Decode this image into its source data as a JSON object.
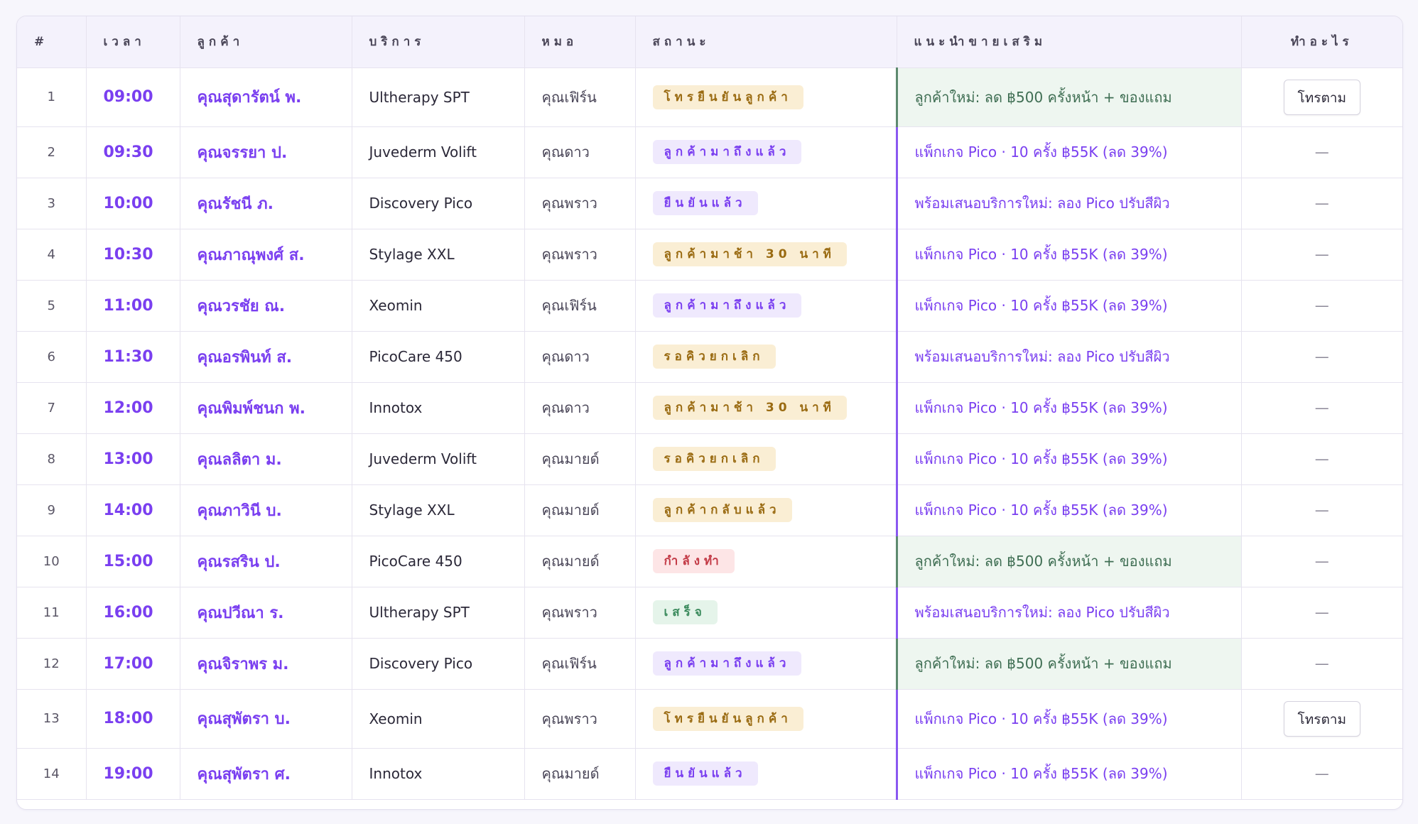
{
  "columns": {
    "num": "#",
    "time": "เวลา",
    "customer": "ลูกค้า",
    "service": "บริการ",
    "doctor": "หมอ",
    "status": "สถานะ",
    "upsell": "แนะนำขายเสริม",
    "action": "ทำอะไร"
  },
  "colors": {
    "accent": "#7a3ff0",
    "promo_bg": "#eef6f0",
    "promo_text": "#3f6e53",
    "badge_amber": "#faeed4",
    "badge_purple": "#efe9fd",
    "badge_red": "#fde5e6",
    "badge_green": "#e5f4ea"
  },
  "rows": [
    {
      "num": "1",
      "time": "09:00",
      "customer": "คุณสุดารัตน์ พ.",
      "service": "Ultherapy SPT",
      "doctor": "คุณเฟิร์น",
      "status": "โทรยืนยันลูกค้า",
      "status_tone": "amber",
      "upsell": "ลูกค้าใหม่: ลด ฿500 ครั้งหน้า + ของแถม",
      "upsell_tone": "promo",
      "action": "โทรตาม",
      "action_type": "button"
    },
    {
      "num": "2",
      "time": "09:30",
      "customer": "คุณจรรยา ป.",
      "service": "Juvederm Volift",
      "doctor": "คุณดาว",
      "status": "ลูกค้ามาถึงแล้ว",
      "status_tone": "purple",
      "upsell": "แพ็กเกจ Pico · 10 ครั้ง ฿55K (ลด 39%)",
      "upsell_tone": "normal",
      "action": "—",
      "action_type": "dash"
    },
    {
      "num": "3",
      "time": "10:00",
      "customer": "คุณรัชนี ภ.",
      "service": "Discovery Pico",
      "doctor": "คุณพราว",
      "status": "ยืนยันแล้ว",
      "status_tone": "purple",
      "upsell": "พร้อมเสนอบริการใหม่: ลอง Pico ปรับสีผิว",
      "upsell_tone": "normal",
      "action": "—",
      "action_type": "dash"
    },
    {
      "num": "4",
      "time": "10:30",
      "customer": "คุณภาณุพงศ์ ส.",
      "service": "Stylage XXL",
      "doctor": "คุณพราว",
      "status": "ลูกค้ามาช้า 30 นาที",
      "status_tone": "amber",
      "upsell": "แพ็กเกจ Pico · 10 ครั้ง ฿55K (ลด 39%)",
      "upsell_tone": "normal",
      "action": "—",
      "action_type": "dash"
    },
    {
      "num": "5",
      "time": "11:00",
      "customer": "คุณวรชัย ณ.",
      "service": "Xeomin",
      "doctor": "คุณเฟิร์น",
      "status": "ลูกค้ามาถึงแล้ว",
      "status_tone": "purple",
      "upsell": "แพ็กเกจ Pico · 10 ครั้ง ฿55K (ลด 39%)",
      "upsell_tone": "normal",
      "action": "—",
      "action_type": "dash"
    },
    {
      "num": "6",
      "time": "11:30",
      "customer": "คุณอรพินท์ ส.",
      "service": "PicoCare 450",
      "doctor": "คุณดาว",
      "status": "รอคิวยกเลิก",
      "status_tone": "amber",
      "upsell": "พร้อมเสนอบริการใหม่: ลอง Pico ปรับสีผิว",
      "upsell_tone": "normal",
      "action": "—",
      "action_type": "dash"
    },
    {
      "num": "7",
      "time": "12:00",
      "customer": "คุณพิมพ์ชนก พ.",
      "service": "Innotox",
      "doctor": "คุณดาว",
      "status": "ลูกค้ามาช้า 30 นาที",
      "status_tone": "amber",
      "upsell": "แพ็กเกจ Pico · 10 ครั้ง ฿55K (ลด 39%)",
      "upsell_tone": "normal",
      "action": "—",
      "action_type": "dash"
    },
    {
      "num": "8",
      "time": "13:00",
      "customer": "คุณลลิตา ม.",
      "service": "Juvederm Volift",
      "doctor": "คุณมายด์",
      "status": "รอคิวยกเลิก",
      "status_tone": "amber",
      "upsell": "แพ็กเกจ Pico · 10 ครั้ง ฿55K (ลด 39%)",
      "upsell_tone": "normal",
      "action": "—",
      "action_type": "dash"
    },
    {
      "num": "9",
      "time": "14:00",
      "customer": "คุณภาวินี บ.",
      "service": "Stylage XXL",
      "doctor": "คุณมายด์",
      "status": "ลูกค้ากลับแล้ว",
      "status_tone": "amber",
      "upsell": "แพ็กเกจ Pico · 10 ครั้ง ฿55K (ลด 39%)",
      "upsell_tone": "normal",
      "action": "—",
      "action_type": "dash"
    },
    {
      "num": "10",
      "time": "15:00",
      "customer": "คุณรสริน ป.",
      "service": "PicoCare 450",
      "doctor": "คุณมายด์",
      "status": "กำลังทำ",
      "status_tone": "red",
      "upsell": "ลูกค้าใหม่: ลด ฿500 ครั้งหน้า + ของแถม",
      "upsell_tone": "promo",
      "action": "—",
      "action_type": "dash"
    },
    {
      "num": "11",
      "time": "16:00",
      "customer": "คุณปวีณา ร.",
      "service": "Ultherapy SPT",
      "doctor": "คุณพราว",
      "status": "เสร็จ",
      "status_tone": "green",
      "upsell": "พร้อมเสนอบริการใหม่: ลอง Pico ปรับสีผิว",
      "upsell_tone": "normal",
      "action": "—",
      "action_type": "dash"
    },
    {
      "num": "12",
      "time": "17:00",
      "customer": "คุณจิราพร ม.",
      "service": "Discovery Pico",
      "doctor": "คุณเฟิร์น",
      "status": "ลูกค้ามาถึงแล้ว",
      "status_tone": "purple",
      "upsell": "ลูกค้าใหม่: ลด ฿500 ครั้งหน้า + ของแถม",
      "upsell_tone": "promo",
      "action": "—",
      "action_type": "dash"
    },
    {
      "num": "13",
      "time": "18:00",
      "customer": "คุณสุพัตรา บ.",
      "service": "Xeomin",
      "doctor": "คุณพราว",
      "status": "โทรยืนยันลูกค้า",
      "status_tone": "amber",
      "upsell": "แพ็กเกจ Pico · 10 ครั้ง ฿55K (ลด 39%)",
      "upsell_tone": "normal",
      "action": "โทรตาม",
      "action_type": "button"
    },
    {
      "num": "14",
      "time": "19:00",
      "customer": "คุณสุพัตรา ศ.",
      "service": "Innotox",
      "doctor": "คุณมายด์",
      "status": "ยืนยันแล้ว",
      "status_tone": "purple",
      "upsell": "แพ็กเกจ Pico · 10 ครั้ง ฿55K (ลด 39%)",
      "upsell_tone": "normal",
      "action": "—",
      "action_type": "dash"
    }
  ]
}
